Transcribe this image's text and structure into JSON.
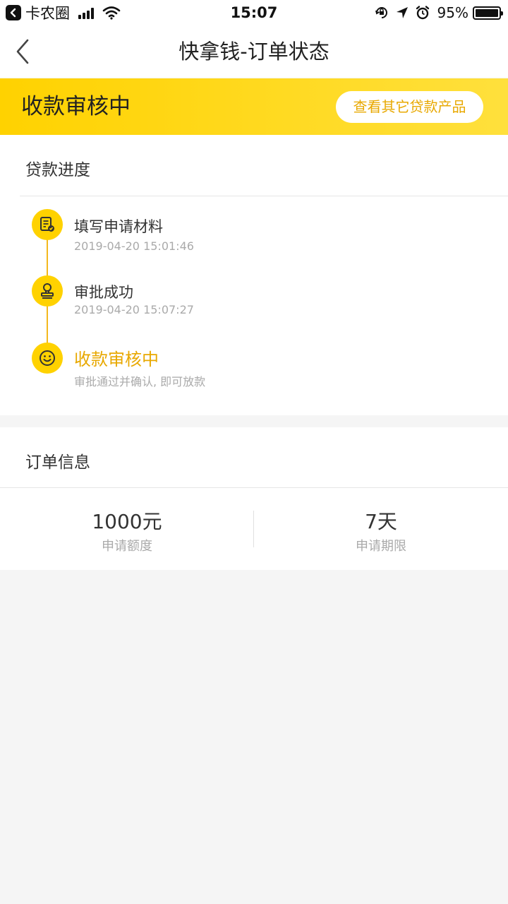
{
  "status_bar": {
    "carrier": "卡农圈",
    "time": "15:07",
    "battery_pct": "95%"
  },
  "nav": {
    "title": "快拿钱-订单状态"
  },
  "banner": {
    "title": "收款审核中",
    "button_label": "查看其它贷款产品"
  },
  "progress": {
    "section_title": "贷款进度",
    "steps": [
      {
        "label": "填写申请材料",
        "sub": "2019-04-20 15:01:46",
        "icon": "document-check-icon"
      },
      {
        "label": "审批成功",
        "sub": "2019-04-20 15:07:27",
        "icon": "stamp-icon"
      },
      {
        "label": "收款审核中",
        "sub": "审批通过并确认, 即可放款",
        "icon": "smile-icon"
      }
    ]
  },
  "order": {
    "section_title": "订单信息",
    "amount_value": "1000元",
    "amount_label": "申请额度",
    "term_value": "7天",
    "term_label": "申请期限"
  },
  "colors": {
    "accent_yellow": "#ffd200",
    "accent_text": "#e8a800",
    "timeline": "#f3b81d"
  }
}
